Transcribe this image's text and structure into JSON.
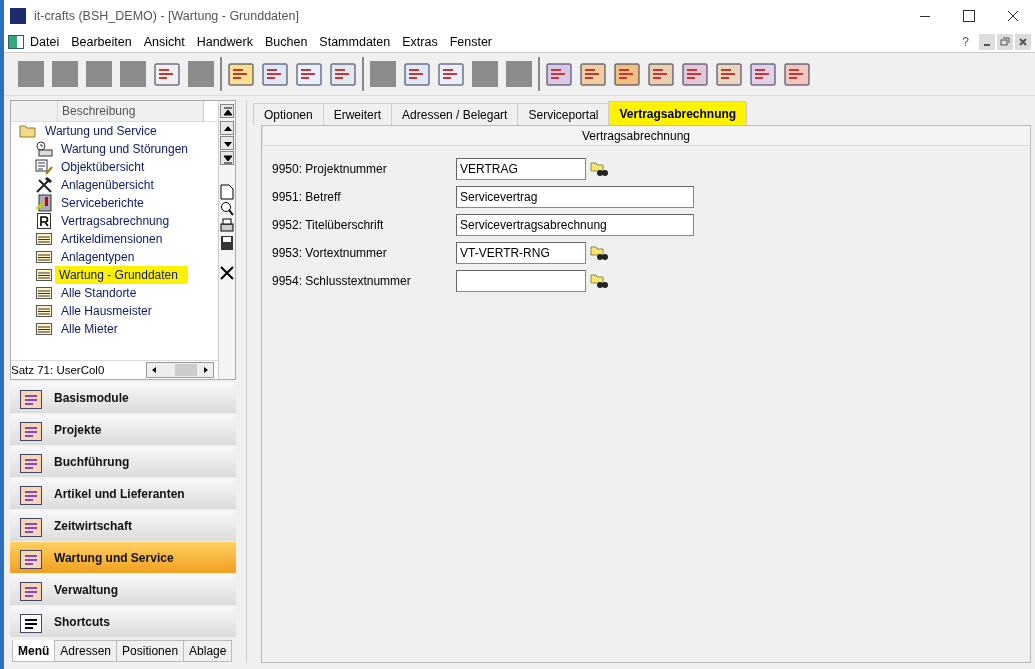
{
  "window": {
    "title": "it-crafts (BSH_DEMO) - [Wartung - Grunddaten]",
    "help": "?"
  },
  "menu": [
    "Datei",
    "Bearbeiten",
    "Ansicht",
    "Handwerk",
    "Buchen",
    "Stammdaten",
    "Extras",
    "Fenster"
  ],
  "toolbar_groups": [
    [
      {
        "disabled": true
      },
      {
        "disabled": true
      },
      {
        "disabled": true
      },
      {
        "disabled": true
      },
      {
        "disabled": false
      },
      {
        "disabled": true
      }
    ],
    [
      {
        "disabled": false
      },
      {
        "disabled": false
      },
      {
        "disabled": false
      },
      {
        "disabled": false
      }
    ],
    [
      {
        "disabled": true
      },
      {
        "disabled": false
      },
      {
        "disabled": false
      },
      {
        "disabled": true
      },
      {
        "disabled": true
      }
    ],
    [
      {
        "disabled": false
      },
      {
        "disabled": false
      },
      {
        "disabled": false
      },
      {
        "disabled": false
      },
      {
        "disabled": false
      },
      {
        "disabled": false
      },
      {
        "disabled": false
      },
      {
        "disabled": false
      }
    ]
  ],
  "tree": {
    "column": "Beschreibung",
    "items": [
      {
        "label": "Wartung und Service",
        "highlighted": false,
        "children": [
          {
            "label": "Wartung und Störungen",
            "highlighted": false
          },
          {
            "label": "Objektübersicht",
            "highlighted": false
          },
          {
            "label": "Anlagenübersicht",
            "highlighted": false
          },
          {
            "label": "Serviceberichte",
            "highlighted": false
          },
          {
            "label": "Vertragsabrechnung",
            "highlighted": false
          },
          {
            "label": "Artikeldimensionen",
            "highlighted": false
          },
          {
            "label": "Anlagentypen",
            "highlighted": false
          },
          {
            "label": "Wartung - Grunddaten",
            "highlighted": true
          },
          {
            "label": "Alle Standorte",
            "highlighted": false
          },
          {
            "label": "Alle Hausmeister",
            "highlighted": false
          },
          {
            "label": "Alle Mieter",
            "highlighted": false
          }
        ]
      }
    ],
    "status": "Satz 71: UserCol0"
  },
  "modules": [
    {
      "label": "Basismodule",
      "selected": false
    },
    {
      "label": "Projekte",
      "selected": false
    },
    {
      "label": "Buchführung",
      "selected": false
    },
    {
      "label": "Artikel und Lieferanten",
      "selected": false
    },
    {
      "label": "Zeitwirtschaft",
      "selected": false
    },
    {
      "label": "Wartung und Service",
      "selected": true
    },
    {
      "label": "Verwaltung",
      "selected": false
    },
    {
      "label": "Shortcuts",
      "selected": false
    }
  ],
  "bottom_tabs": [
    {
      "label": "Menü",
      "selected": true
    },
    {
      "label": "Adressen",
      "selected": false
    },
    {
      "label": "Positionen",
      "selected": false
    },
    {
      "label": "Ablage",
      "selected": false
    }
  ],
  "tabs": [
    {
      "label": "Optionen",
      "selected": false,
      "highlighted": false
    },
    {
      "label": "Erweitert",
      "selected": false,
      "highlighted": false
    },
    {
      "label": "Adressen / Belegart",
      "selected": false,
      "highlighted": false
    },
    {
      "label": "Serviceportal",
      "selected": false,
      "highlighted": false
    },
    {
      "label": "Vertragsabrechnung",
      "selected": true,
      "highlighted": true
    }
  ],
  "section": "Vertragsabrechnung",
  "fields": [
    {
      "label": "9950: Projektnummer",
      "value": "VERTRAG",
      "lookup": true
    },
    {
      "label": "9951: Betreff",
      "value": "Servicevertrag",
      "lookup": false
    },
    {
      "label": "9952: Titelüberschrift",
      "value": "Servicevertragsabrechnung",
      "lookup": false
    },
    {
      "label": "9953: Vortextnummer",
      "value": "VT-VERTR-RNG",
      "lookup": true
    },
    {
      "label": "9954: Schlusstextnummer",
      "lookup": true
    }
  ]
}
